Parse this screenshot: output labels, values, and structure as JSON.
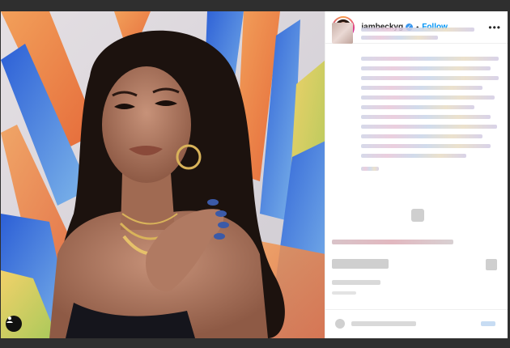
{
  "post": {
    "username": "iambeckyg",
    "verified_glyph": "✓",
    "separator": "•",
    "follow_label": "Follow",
    "more_label": "•••"
  },
  "icons": {
    "tag": "user-tag-icon",
    "more": "more-options-icon",
    "verified": "verified-badge-icon"
  },
  "colors": {
    "follow": "#0095f6",
    "verified": "#3897f0",
    "page_background": "#2f2f2f"
  }
}
